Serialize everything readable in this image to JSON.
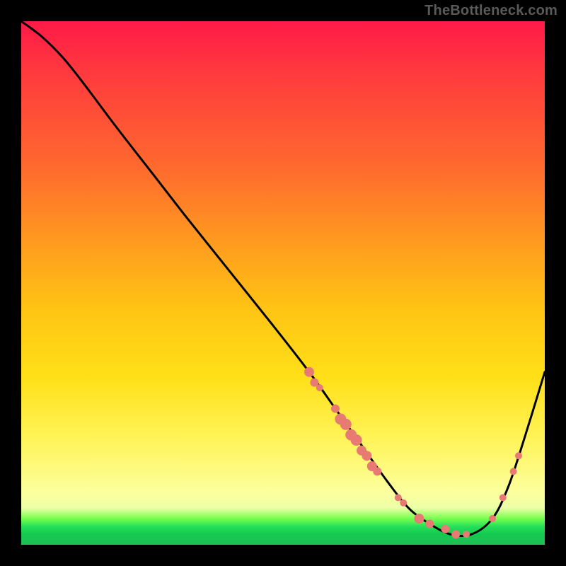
{
  "watermark": "TheBottleneck.com",
  "chart_data": {
    "type": "line",
    "title": "",
    "xlabel": "",
    "ylabel": "",
    "xlim": [
      0,
      100
    ],
    "ylim": [
      0,
      100
    ],
    "grid": false,
    "legend": false,
    "background": "rainbow-gradient",
    "series": [
      {
        "name": "curve",
        "color": "#000000",
        "x": [
          0,
          4,
          8,
          12,
          18,
          25,
          32,
          40,
          48,
          55,
          60,
          65,
          70,
          74,
          78,
          82,
          86,
          90,
          93,
          96,
          100
        ],
        "y": [
          100,
          97,
          93,
          88,
          80,
          71,
          62,
          52,
          42,
          33,
          26,
          19,
          12,
          7,
          4,
          2,
          2,
          5,
          11,
          20,
          33
        ]
      }
    ],
    "markers": {
      "color": "#e77b74",
      "radius_small": 5,
      "radius_large": 8,
      "points": [
        {
          "x": 55,
          "y": 33,
          "r": 7
        },
        {
          "x": 56,
          "y": 31,
          "r": 6
        },
        {
          "x": 57,
          "y": 30,
          "r": 5
        },
        {
          "x": 60,
          "y": 26,
          "r": 6
        },
        {
          "x": 61,
          "y": 24,
          "r": 8
        },
        {
          "x": 62,
          "y": 23,
          "r": 8
        },
        {
          "x": 63,
          "y": 21,
          "r": 8
        },
        {
          "x": 64,
          "y": 20,
          "r": 8
        },
        {
          "x": 65,
          "y": 18,
          "r": 7
        },
        {
          "x": 66,
          "y": 17,
          "r": 7
        },
        {
          "x": 67,
          "y": 15,
          "r": 7
        },
        {
          "x": 68,
          "y": 14,
          "r": 6
        },
        {
          "x": 72,
          "y": 9,
          "r": 5
        },
        {
          "x": 73,
          "y": 8,
          "r": 5
        },
        {
          "x": 76,
          "y": 5,
          "r": 7
        },
        {
          "x": 78,
          "y": 4,
          "r": 6
        },
        {
          "x": 81,
          "y": 3,
          "r": 6
        },
        {
          "x": 83,
          "y": 2,
          "r": 6
        },
        {
          "x": 85,
          "y": 2,
          "r": 5
        },
        {
          "x": 90,
          "y": 5,
          "r": 5
        },
        {
          "x": 92,
          "y": 9,
          "r": 5
        },
        {
          "x": 94,
          "y": 14,
          "r": 5
        },
        {
          "x": 95,
          "y": 17,
          "r": 5
        }
      ]
    }
  }
}
